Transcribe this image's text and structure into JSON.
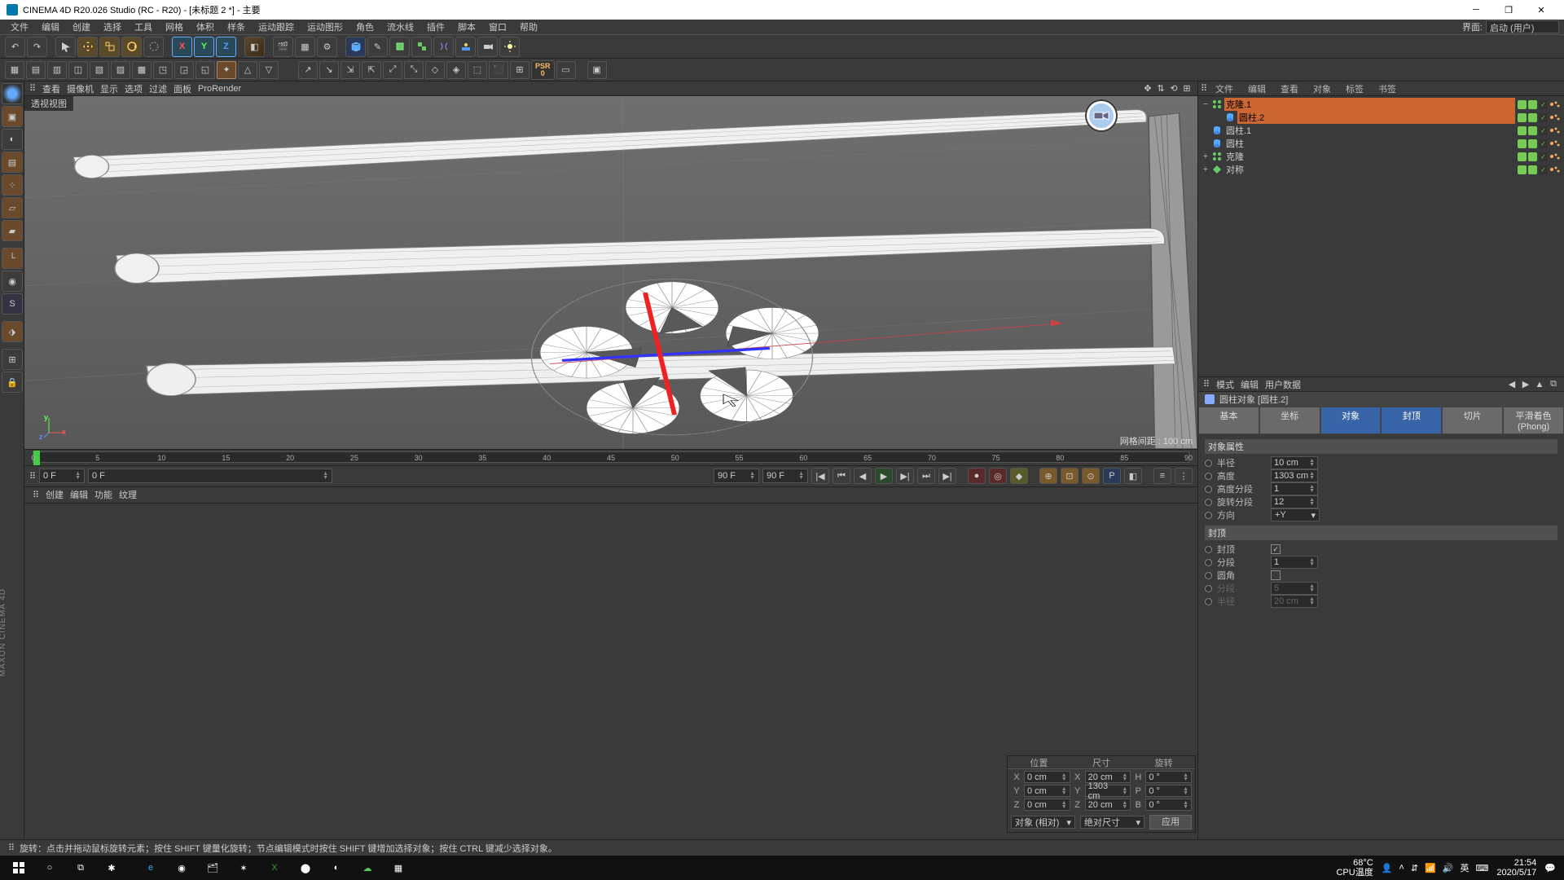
{
  "title": "CINEMA 4D R20.026 Studio (RC - R20) - [未标题 2 *] - 主要",
  "menubar": [
    "文件",
    "编辑",
    "创建",
    "选择",
    "工具",
    "网格",
    "体积",
    "样条",
    "运动跟踪",
    "运动图形",
    "角色",
    "流水线",
    "插件",
    "脚本",
    "窗口",
    "帮助"
  ],
  "layout_label": "界面:",
  "layout_value": "启动 (用户)",
  "psr": {
    "label": "PSR",
    "value": "0"
  },
  "viewport_menu": [
    "查看",
    "摄像机",
    "显示",
    "选项",
    "过滤",
    "面板",
    "ProRender"
  ],
  "viewport_label": "透视视图",
  "viewport_grid_info": "网格间距 : 100 cm",
  "timeline": {
    "marks": [
      0,
      5,
      10,
      15,
      20,
      25,
      30,
      35,
      40,
      45,
      50,
      55,
      60,
      65,
      70,
      75,
      80,
      85,
      90
    ]
  },
  "playback": {
    "start": "0 F",
    "cur": "0 F",
    "end1": "90 F",
    "end2": "90 F"
  },
  "material_menu": [
    "创建",
    "编辑",
    "功能",
    "纹理"
  ],
  "right_tabs_top": [
    "文件",
    "编辑",
    "查看",
    "对象",
    "标签",
    "书签"
  ],
  "right_tabs_top_sel": 3,
  "objects": [
    {
      "depth": 0,
      "exp": "−",
      "icon": "clone",
      "name": "克隆.1",
      "sel": true
    },
    {
      "depth": 1,
      "exp": "",
      "icon": "cyl",
      "name": "圆柱.2",
      "sel": true
    },
    {
      "depth": 0,
      "exp": "",
      "icon": "cyl",
      "name": "圆柱.1"
    },
    {
      "depth": 0,
      "exp": "",
      "icon": "cyl",
      "name": "圆柱"
    },
    {
      "depth": 0,
      "exp": "+",
      "icon": "clone",
      "name": "克隆"
    },
    {
      "depth": 0,
      "exp": "+",
      "icon": "sym",
      "name": "对称"
    }
  ],
  "attr_tabs": [
    "模式",
    "编辑",
    "用户数据"
  ],
  "attr_title": "圆柱对象 [圆柱.2]",
  "attr_subtabs": [
    "基本",
    "坐标",
    "对象",
    "封顶",
    "切片",
    "平滑着色(Phong)"
  ],
  "attr_subtabs_sel": [
    2,
    3
  ],
  "attr_section1": "对象属性",
  "attr_rows": [
    {
      "label": "半径",
      "value": "10 cm",
      "type": "num"
    },
    {
      "label": "高度",
      "value": "1303 cm",
      "type": "num"
    },
    {
      "label": "高度分段",
      "value": "1",
      "type": "num"
    },
    {
      "label": "旋转分段",
      "value": "12",
      "type": "num"
    },
    {
      "label": "方向",
      "value": "+Y",
      "type": "drop"
    }
  ],
  "attr_section2": "封顶",
  "attr_rows2": [
    {
      "label": "封顶",
      "type": "check",
      "checked": true
    },
    {
      "label": "分段",
      "value": "1",
      "type": "num"
    },
    {
      "label": "圆角",
      "type": "check",
      "checked": false
    },
    {
      "label": "分段",
      "value": "5",
      "type": "num",
      "dim": true
    },
    {
      "label": "半径",
      "value": "20 cm",
      "type": "num",
      "dim": true
    }
  ],
  "coord": {
    "headers": [
      "位置",
      "尺寸",
      "旋转"
    ],
    "rows": [
      {
        "a": "X",
        "v1": "0 cm",
        "b": "X",
        "v2": "20 cm",
        "c": "H",
        "v3": "0 °"
      },
      {
        "a": "Y",
        "v1": "0 cm",
        "b": "Y",
        "v2": "1303 cm",
        "c": "P",
        "v3": "0 °"
      },
      {
        "a": "Z",
        "v1": "0 cm",
        "b": "Z",
        "v2": "20 cm",
        "c": "B",
        "v3": "0 °"
      }
    ],
    "sel1": "对象 (相对)",
    "sel2": "绝对尺寸",
    "apply": "应用"
  },
  "status": "旋转：点击并拖动鼠标旋转元素；按住 SHIFT 键量化旋转；节点编辑模式时按住 SHIFT 键增加选择对象；按住 CTRL 键减少选择对象。",
  "taskbar": {
    "temp": "68°C",
    "templabel": "CPU温度",
    "ime": "英",
    "time": "21:54",
    "date": "2020/5/17"
  },
  "side_text": "MAXON CINEMA 4D"
}
